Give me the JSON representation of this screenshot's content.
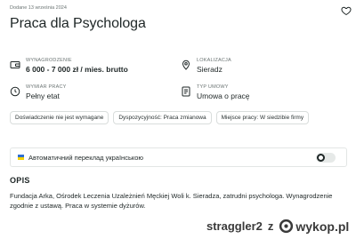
{
  "header": {
    "date": "Dodane 13 września 2024",
    "title": "Praca dla Psychologa"
  },
  "details": {
    "salary": {
      "label": "WYNAGRODZENIE",
      "value": "6 000 - 7 000 zł / mies. brutto",
      "icon": "wallet-icon"
    },
    "location": {
      "label": "LOKALIZACJA",
      "value": "Sieradz",
      "icon": "location-pin-icon"
    },
    "work_time": {
      "label": "WYMIAR PRACY",
      "value": "Pełny etat",
      "icon": "clock-icon"
    },
    "contract": {
      "label": "TYP UMOWY",
      "value": "Umowa o pracę",
      "icon": "contract-icon"
    }
  },
  "tags": [
    "Doświadczenie nie jest wymagane",
    "Dyspozycyjność: Praca zmianowa",
    "Miejsce pracy: W siedzibie firmy"
  ],
  "translation": {
    "label": "Автоматичний переклад українською",
    "enabled": false,
    "flag_colors": [
      "#2f6fd1",
      "#f6d200"
    ]
  },
  "description": {
    "heading": "OPIS",
    "text": "Fundacja Arka, Ośrodek Leczenia Uzależnień Męckiej Woli k. Sieradza, zatrudni psychologa. Wynagrodzenie zgodnie z ustawą. Praca w systemie dyżurów."
  },
  "watermark": {
    "user": "straggler2",
    "z": "z",
    "site": "wykop.pl"
  }
}
